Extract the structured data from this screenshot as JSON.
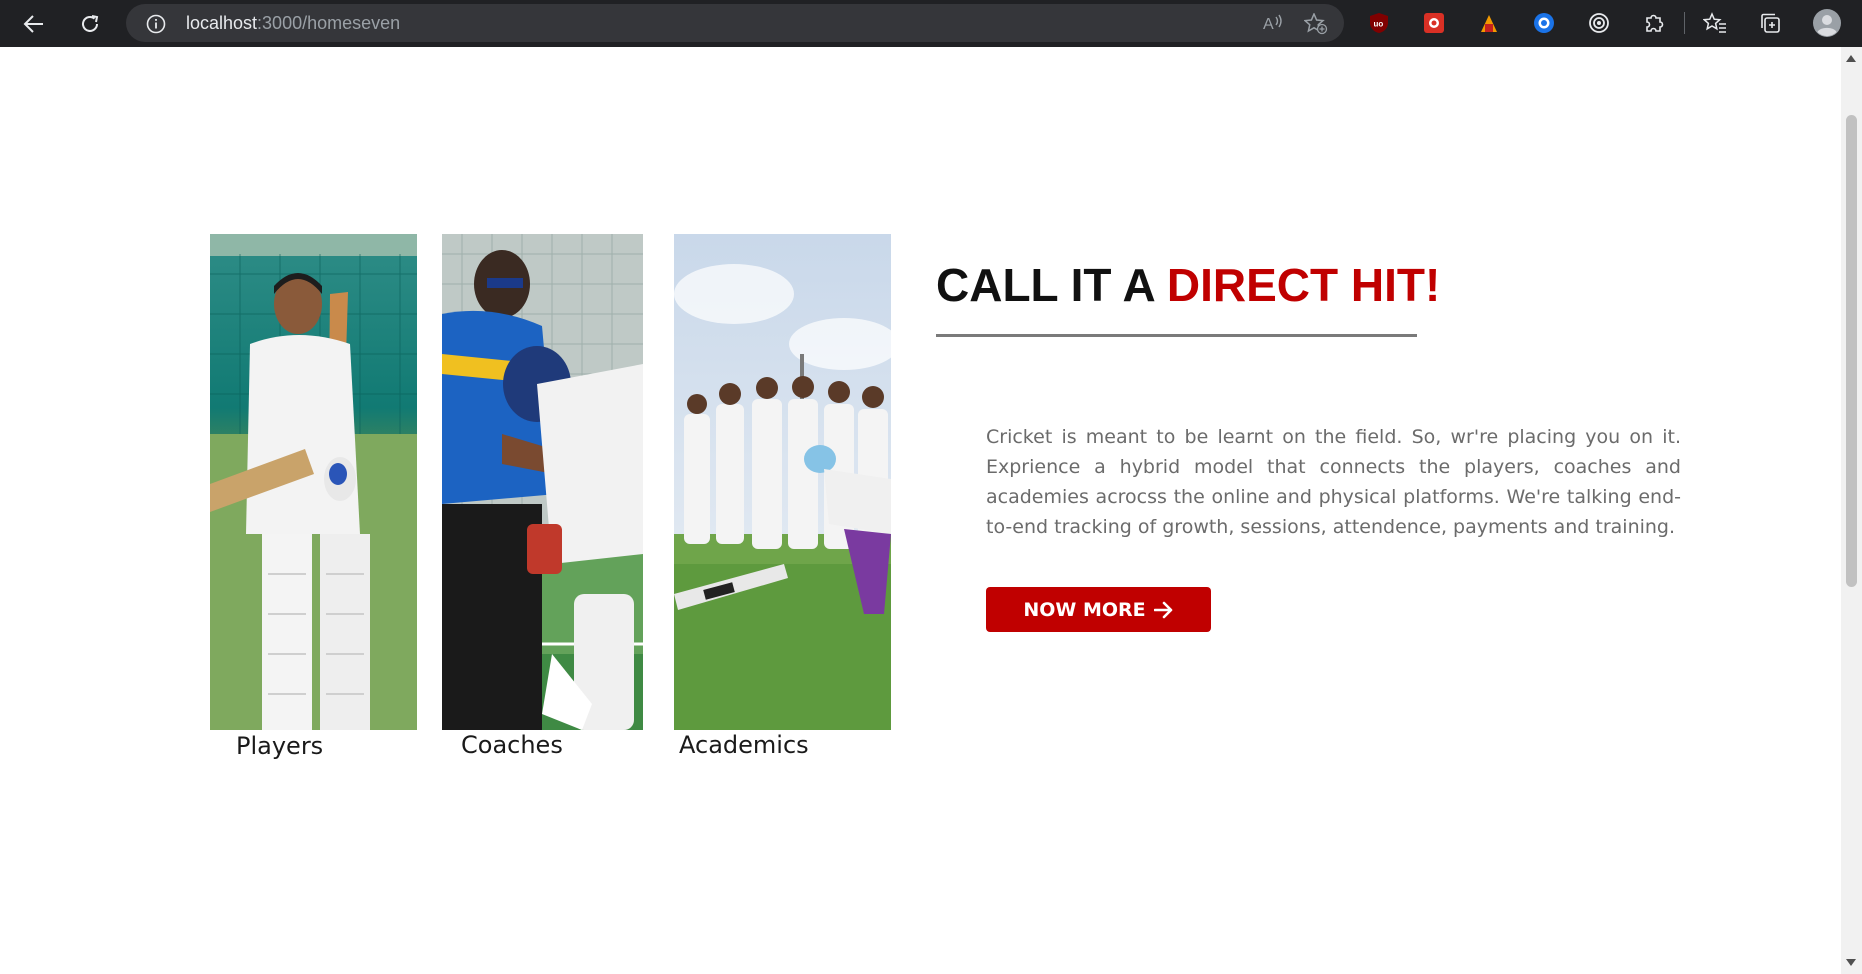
{
  "browser": {
    "url_host": "localhost",
    "url_path": ":3000/homeseven"
  },
  "colors": {
    "accent": "#c00000",
    "heading": "#111111",
    "body_text": "#6b6b6b",
    "chrome": "#202124"
  },
  "cards": [
    {
      "label": "Players",
      "icon": "cricket-batsman-photo"
    },
    {
      "label": "Coaches",
      "icon": "coach-training-photo"
    },
    {
      "label": "Academics",
      "icon": "academy-group-photo"
    }
  ],
  "heading": {
    "lead": "CALL IT A ",
    "accent": "DIRECT HIT!"
  },
  "description": "Cricket is meant to be learnt on the field. So, wr're placing you on it. Exprience a hybrid model that connects the players, coaches and academies acrocss the online and physical platforms. We're talking end-to-end tracking of growth, sessions, attendence, payments and training.",
  "cta": {
    "label": "NOW MORE",
    "icon": "arrow-right-icon"
  }
}
